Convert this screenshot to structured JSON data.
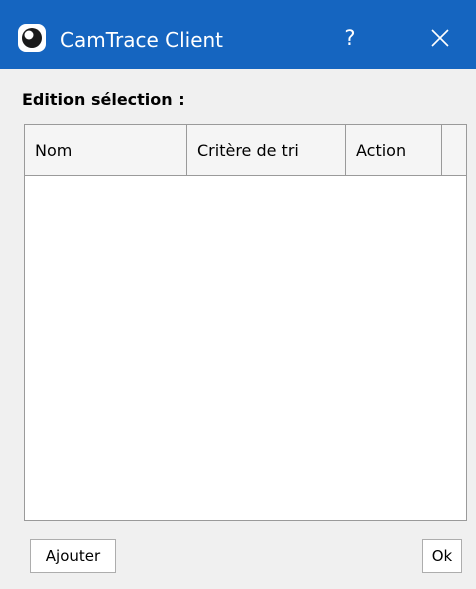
{
  "window": {
    "title": "CamTrace Client",
    "help_label": "?",
    "icons": {
      "app": "camtrace-logo-icon",
      "close": "close-icon"
    },
    "colors": {
      "titlebar": "#1565c0",
      "background": "#f0f0f0"
    }
  },
  "section": {
    "label": "Edition sélection :"
  },
  "table": {
    "columns": [
      "Nom",
      "Critère de tri",
      "Action"
    ],
    "rows": []
  },
  "buttons": {
    "add_label": "Ajouter",
    "ok_label": "Ok"
  }
}
